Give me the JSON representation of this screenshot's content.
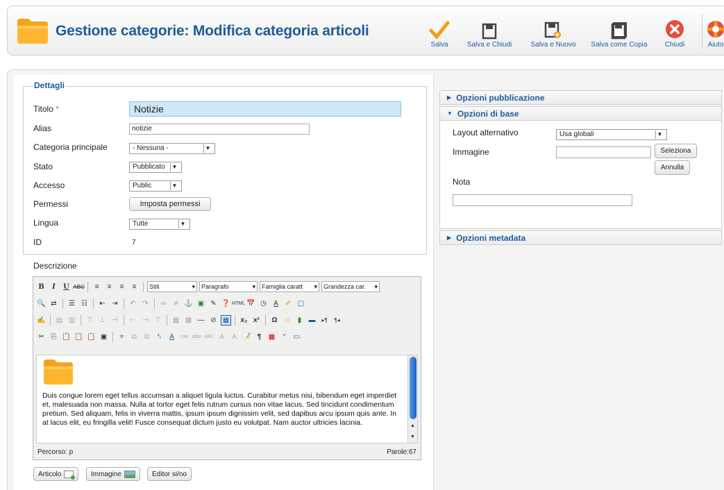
{
  "toolbar": {
    "title": "Gestione categorie: Modifica categoria articoli",
    "buttons": [
      {
        "label": "Salva",
        "icon": "checkmark-icon"
      },
      {
        "label": "Salva e Chiudi",
        "icon": "save-close-icon"
      },
      {
        "label": "Salva e Nuovo",
        "icon": "save-new-icon"
      },
      {
        "label": "Salva come Copia",
        "icon": "save-copy-icon"
      },
      {
        "label": "Chiudi",
        "icon": "close-icon"
      },
      {
        "label": "Aiuto",
        "icon": "help-lifebuoy-icon"
      }
    ]
  },
  "details": {
    "legend": "Dettagli",
    "title_label": "Titolo",
    "title_required": "*",
    "title_value": "Notizie",
    "alias_label": "Alias",
    "alias_value": "notizie",
    "parent_label": "Categoria principale",
    "parent_value": "- Nessuna -",
    "state_label": "Stato",
    "state_value": "Pubblicato",
    "access_label": "Accesso",
    "access_value": "Public",
    "permissions_label": "Permessi",
    "permissions_button": "Imposta permessi",
    "language_label": "Lingua",
    "language_value": "Tutte",
    "id_label": "ID",
    "id_value": "7"
  },
  "description": {
    "label": "Descrizione",
    "style_select": "Stili",
    "format_select": "Paragrafo",
    "font_family_select": "Famiglia caratt",
    "font_size_select": "Grandezza car.",
    "body_text": "Duis congue lorem eget tellus accumsan a aliquet ligula luctus. Curabitur metus nisi, bibendum eget imperdiet et, malesuada non massa. Nulla at tortor eget felis rutrum cursus non vitae lacus. Sed tincidunt condimentum pretium. Sed aliquam, felis in viverra mattis, ipsum ipsum dignissim velit, sed dapibus arcu ipsum quis ante. In at lacus elit, eu fringilla velit! Fusce consequat dictum justo eu volutpat. Nam auctor ultricies lacinia.",
    "path": "Percorso: p",
    "word_count": "Parole:67"
  },
  "editor_buttons": {
    "article": "Articolo",
    "image": "Immagine",
    "toggle": "Editor si/no"
  },
  "right": {
    "publishing": "Opzioni pubblicazione",
    "basic": "Opzioni di base",
    "layout_label": "Layout alternativo",
    "layout_value": "Usa globali",
    "image_label": "Immagine",
    "select_button": "Seleziona",
    "cancel_button": "Annulla",
    "note_label": "Nota",
    "metadata": "Opzioni metadata"
  },
  "colors": {
    "accent": "#1d5c99",
    "title_input_bg": "#cde8f7",
    "save_check": "#f39c12",
    "close_red": "#e74c3c"
  }
}
